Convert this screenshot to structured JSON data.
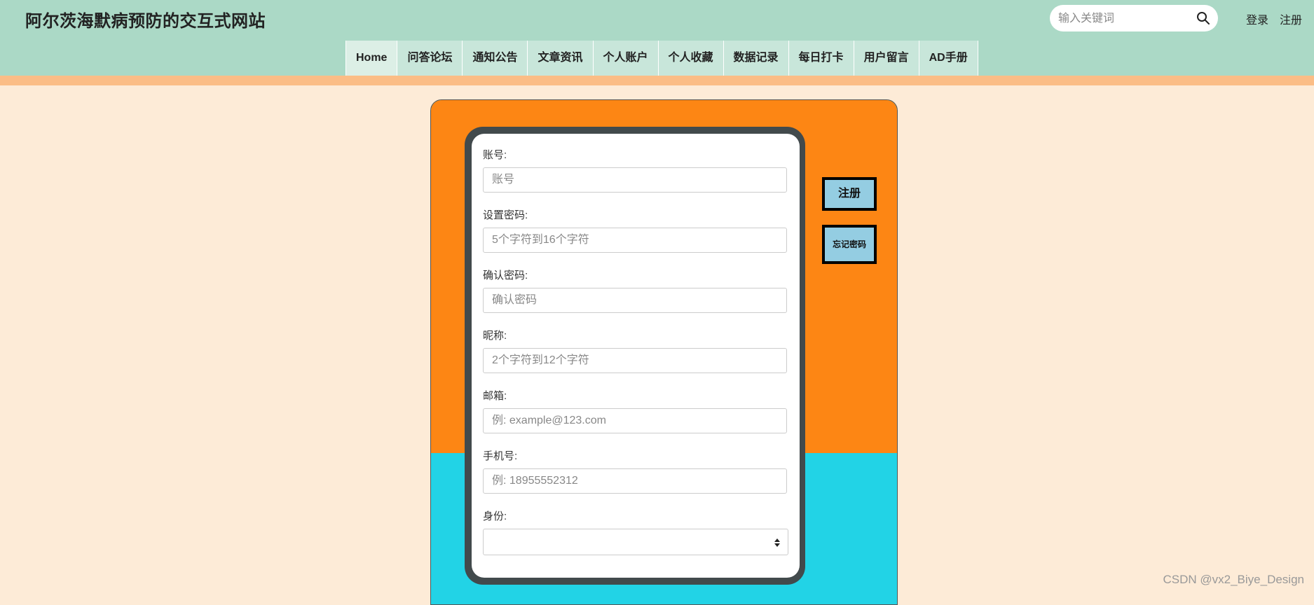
{
  "header": {
    "site_title": "阿尔茨海默病预防的交互式网站",
    "search_placeholder": "输入关键词",
    "login_label": "登录",
    "register_label": "注册"
  },
  "nav": {
    "items": [
      "Home",
      "问答论坛",
      "通知公告",
      "文章资讯",
      "个人账户",
      "个人收藏",
      "数据记录",
      "每日打卡",
      "用户留言",
      "AD手册"
    ],
    "active": "Home"
  },
  "form": {
    "account": {
      "label": "账号:",
      "placeholder": "账号",
      "value": ""
    },
    "password": {
      "label": "设置密码:",
      "placeholder": "5个字符到16个字符",
      "value": ""
    },
    "confirm_password": {
      "label": "确认密码:",
      "placeholder": "确认密码",
      "value": ""
    },
    "nickname": {
      "label": "昵称:",
      "placeholder": "2个字符到12个字符",
      "value": ""
    },
    "email": {
      "label": "邮箱:",
      "placeholder": "例: example@123.com",
      "value": ""
    },
    "phone": {
      "label": "手机号:",
      "placeholder": "例: 18955552312",
      "value": ""
    },
    "identity": {
      "label": "身份:",
      "selected": ""
    }
  },
  "side_buttons": {
    "register": "注册",
    "forgot_password": "忘记密码"
  },
  "watermark": "CSDN @vx2_Biye_Design",
  "colors": {
    "header_bg": "#abd9c6",
    "nav_item_bg": "#c8e6da",
    "stripe": "#fbbd86",
    "page_bg": "#fdebd7",
    "panel_orange": "#fd8614",
    "panel_cyan": "#22d3e6",
    "form_frame": "#424a4c",
    "side_button_bg": "#94cde2"
  },
  "icons": {
    "search": "search-icon",
    "select_arrows": "sort-arrows-icon"
  }
}
